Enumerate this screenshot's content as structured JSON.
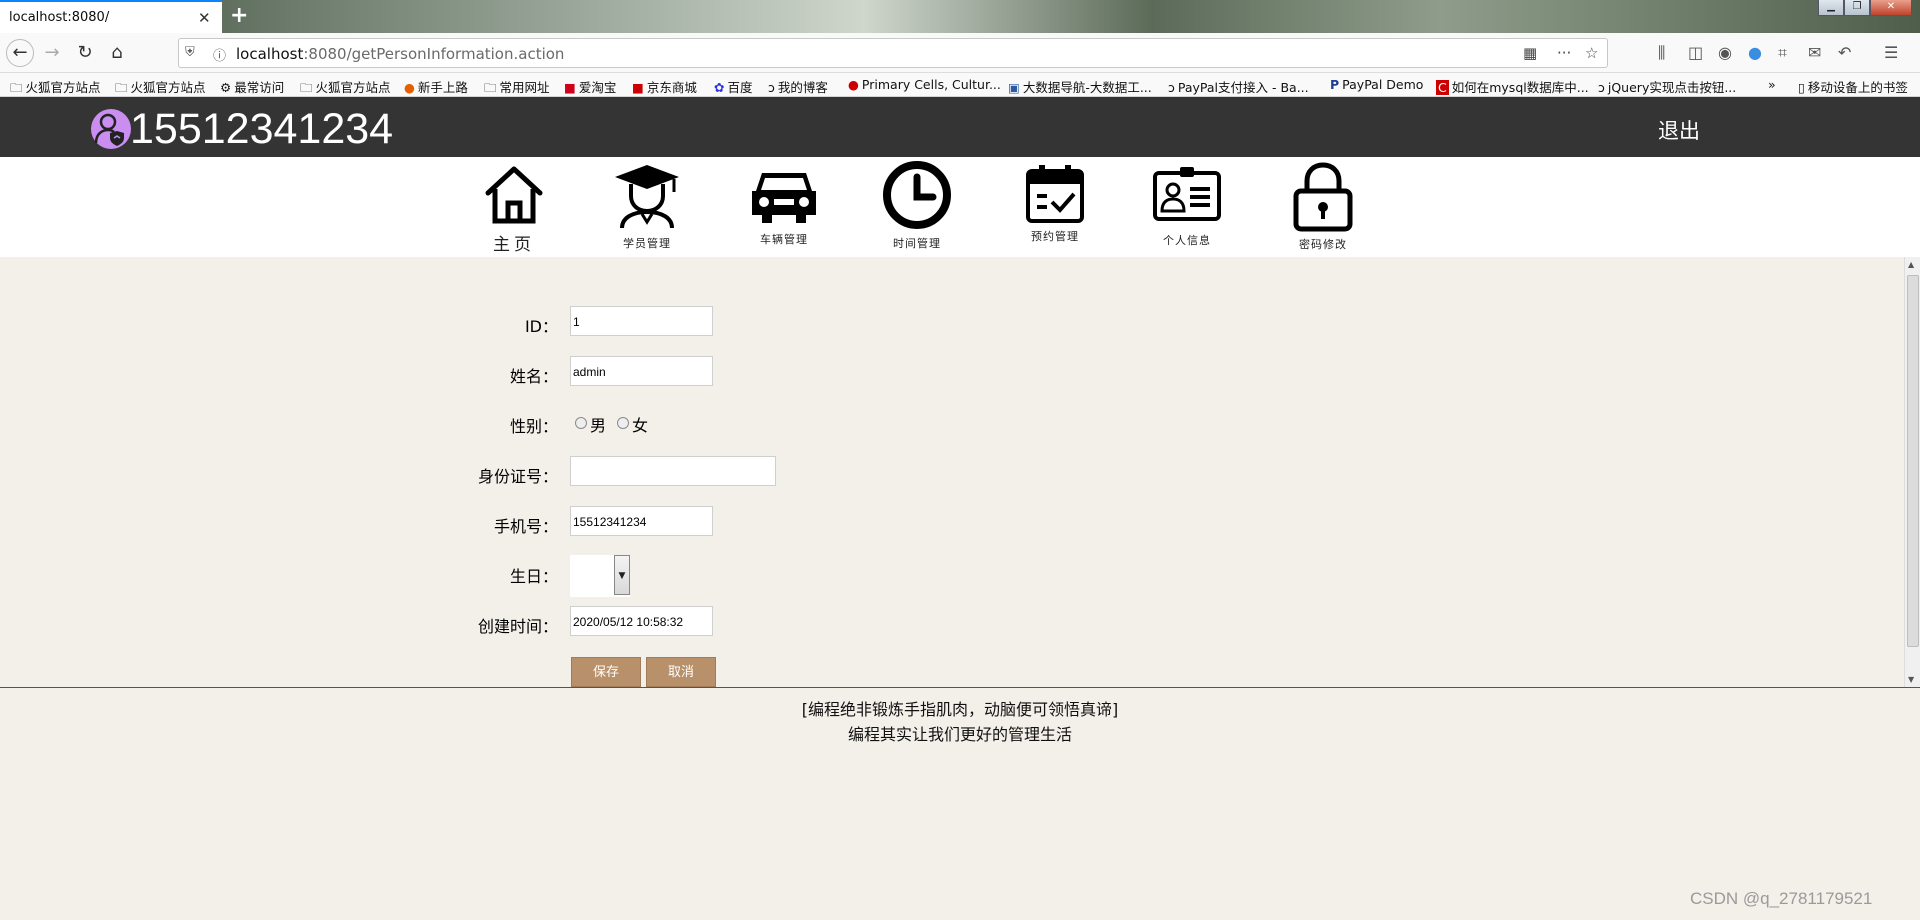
{
  "browser": {
    "tab_title": "localhost:8080/",
    "url_host": "localhost",
    "url_rest": ":8080/getPersonInformation.action",
    "bookmarks": [
      "火狐官方站点",
      "火狐官方站点",
      "最常访问",
      "火狐官方站点",
      "新手上路",
      "常用网址",
      "爱淘宝",
      "京东商城",
      "百度",
      "我的博客",
      "Primary Cells, Cultur...",
      "大数据导航-大数据工...",
      "PayPal支付接入 - Ba...",
      "PayPal Demo",
      "如何在mysql数据库中...",
      "jQuery实现点击按钮...",
      "移动设备上的书签"
    ]
  },
  "header": {
    "user_number": "15512341234",
    "logout_label": "退出"
  },
  "nav": {
    "items": [
      {
        "label": "主页",
        "icon": "home-icon"
      },
      {
        "label": "学员管理",
        "icon": "student-icon"
      },
      {
        "label": "车辆管理",
        "icon": "car-icon"
      },
      {
        "label": "时间管理",
        "icon": "clock-icon"
      },
      {
        "label": "预约管理",
        "icon": "calendar-icon"
      },
      {
        "label": "个人信息",
        "icon": "id-card-icon"
      },
      {
        "label": "密码修改",
        "icon": "lock-icon"
      }
    ]
  },
  "form": {
    "id_label": "ID：",
    "id_value": "1",
    "name_label": "姓名：",
    "name_value": "admin",
    "gender_label": "性别：",
    "gender_male": "男",
    "gender_female": "女",
    "idcard_label": "身份证号：",
    "idcard_value": "",
    "phone_label": "手机号：",
    "phone_value": "15512341234",
    "birthday_label": "生日：",
    "created_label": "创建时间：",
    "created_value": "2020/05/12 10:58:32",
    "save_label": "保存",
    "cancel_label": "取消"
  },
  "footer": {
    "line1": "[编程绝非锻炼手指肌肉，动脑便可领悟真谛]",
    "line2": "编程其实让我们更好的管理生活"
  },
  "watermark": "CSDN @q_2781179521",
  "colors": {
    "header_bg": "#343434",
    "button_bg": "#b8906a",
    "page_bg": "#f3f0ea",
    "avatar": "#c98ef0"
  }
}
